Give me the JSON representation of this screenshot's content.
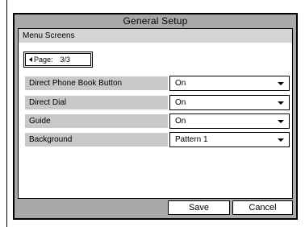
{
  "window": {
    "title": "General Setup"
  },
  "section": {
    "title": "Menu Screens"
  },
  "pager": {
    "label": "Page:",
    "value": "3/3"
  },
  "settings": [
    {
      "label": "Direct Phone Book Button",
      "value": "On"
    },
    {
      "label": "Direct Dial",
      "value": "On"
    },
    {
      "label": "Guide",
      "value": "On"
    },
    {
      "label": "Background",
      "value": "Pattern 1"
    }
  ],
  "footer": {
    "save_label": "Save",
    "cancel_label": "Cancel"
  },
  "icons": {
    "page_prev": "left-triangle-icon",
    "dropdown": "chevron-down-icon"
  },
  "colors": {
    "frame": "#a9a9a9",
    "section_header": "#d4d4d4",
    "row_label": "#c8c8c8"
  }
}
